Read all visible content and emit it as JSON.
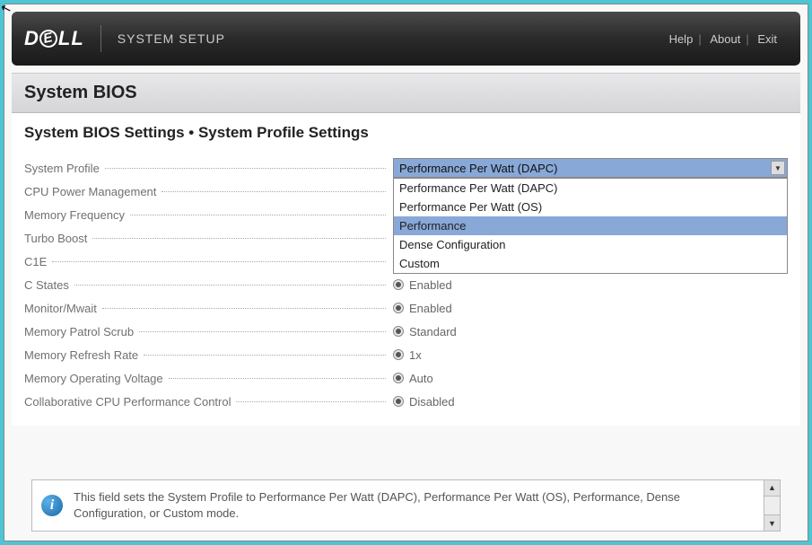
{
  "header": {
    "logo_text": "DELL",
    "title": "SYSTEM SETUP",
    "links": {
      "help": "Help",
      "about": "About",
      "exit": "Exit"
    }
  },
  "page_title": "System BIOS",
  "breadcrumb": "System BIOS Settings • System Profile Settings",
  "settings": {
    "system_profile": {
      "label": "System Profile",
      "selected": "Performance Per Watt (DAPC)",
      "options": [
        "Performance Per Watt (DAPC)",
        "Performance Per Watt (OS)",
        "Performance",
        "Dense Configuration",
        "Custom"
      ],
      "highlight_index": 2
    },
    "cpu_power": {
      "label": "CPU Power Management"
    },
    "memory_freq": {
      "label": "Memory Frequency"
    },
    "turbo_boost": {
      "label": "Turbo Boost"
    },
    "c1e": {
      "label": "C1E"
    },
    "c_states": {
      "label": "C States",
      "value": "Enabled"
    },
    "monitor_mwait": {
      "label": "Monitor/Mwait",
      "value": "Enabled"
    },
    "mem_patrol": {
      "label": "Memory Patrol Scrub",
      "value": "Standard"
    },
    "mem_refresh": {
      "label": "Memory Refresh Rate",
      "value": "1x"
    },
    "mem_voltage": {
      "label": "Memory Operating Voltage",
      "value": "Auto"
    },
    "collab_cpu": {
      "label": "Collaborative CPU Performance Control",
      "value": "Disabled"
    }
  },
  "help_text": "This field sets the System Profile to Performance Per Watt (DAPC), Performance Per Watt (OS), Performance, Dense Configuration, or Custom mode."
}
